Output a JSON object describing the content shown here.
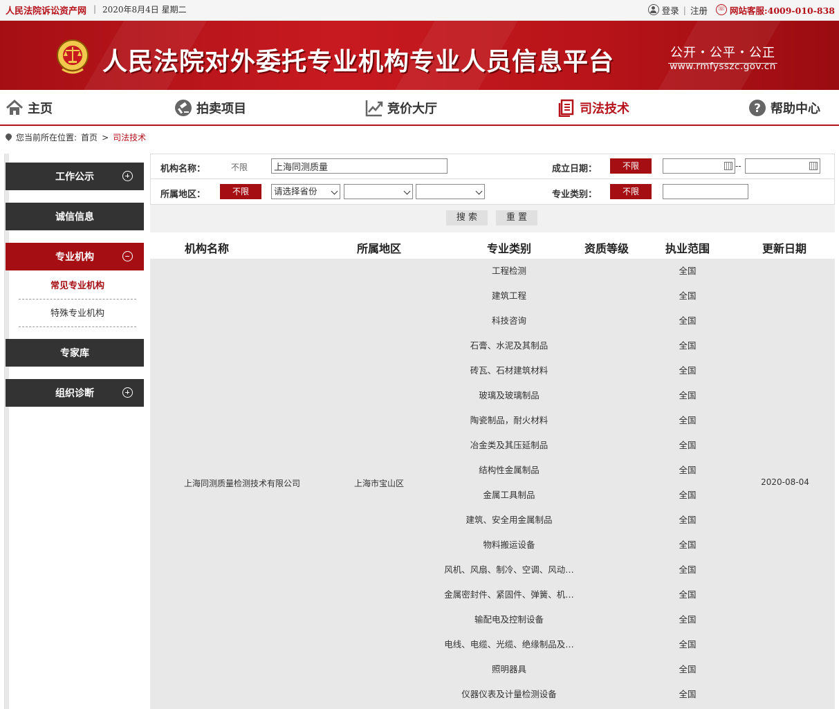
{
  "topbar": {
    "site_name": "人民法院诉讼资产网",
    "separator": "|",
    "date": "2020年8月4日  星期二",
    "login": "登录",
    "divider": "|",
    "register": "注册",
    "hotline": "网站客服:4009-010-838"
  },
  "banner": {
    "title": "人民法院对外委托专业机构专业人员信息平台",
    "slogan": "公开・公平・公正",
    "url": "www.rmfysszc.gov.cn"
  },
  "nav": {
    "items": [
      {
        "label": "主页",
        "icon": "home-icon"
      },
      {
        "label": "拍卖项目",
        "icon": "gavel-icon"
      },
      {
        "label": "竞价大厅",
        "icon": "chart-icon"
      },
      {
        "label": "司法技术",
        "icon": "document-icon"
      },
      {
        "label": "帮助中心",
        "icon": "help-icon"
      }
    ],
    "active": "司法技术"
  },
  "breadcrumb": {
    "prefix": "您当前所在位置:",
    "home": "首页",
    "arrow": ">",
    "current": "司法技术"
  },
  "sidebar": {
    "sections": [
      {
        "label": "工作公示",
        "toggle": "plus"
      },
      {
        "label": "诚信信息"
      },
      {
        "label": "专业机构",
        "toggle": "minus"
      },
      {
        "label": "专家库"
      },
      {
        "label": "组织诊断",
        "toggle": "plus"
      }
    ],
    "sub_items": [
      "常见专业机构",
      "特殊专业机构"
    ]
  },
  "filter": {
    "name_label": "机构名称：",
    "name_unlimited": "不限",
    "name_value": "上海同测质量",
    "date_label": "成立日期：",
    "date_unlimited": "不限",
    "date_separator": "--",
    "region_label": "所属地区：",
    "region_unlimited": "不限",
    "province_placeholder": "请选择省份",
    "category_label": "专业类别：",
    "category_unlimited": "不限"
  },
  "actions": {
    "search": "搜 索",
    "reset": "重 置"
  },
  "table": {
    "headers": [
      "机构名称",
      "所属地区",
      "专业类别",
      "资质等级",
      "执业范围",
      "更新日期"
    ],
    "row": {
      "name": "上海同测质量检测技术有限公司",
      "region": "上海市宝山区",
      "updated": "2020-08-04",
      "categories": [
        "工程检测",
        "建筑工程",
        "科技咨询",
        "石膏、水泥及其制品",
        "砖瓦、石材建筑材料",
        "玻璃及玻璃制品",
        "陶瓷制品，耐火材料",
        "冶金类及其压延制品",
        "结构性金属制品",
        "金属工具制品",
        "建筑、安全用金属制品",
        "物料搬运设备",
        "风机、风扇、制冷、空调、风动…",
        "金属密封件、紧固件、弹簧、机…",
        "输配电及控制设备",
        "电线、电缆、光缆、绝缘制品及…",
        "照明器具",
        "仪器仪表及计量检测设备"
      ],
      "scope": "全国"
    }
  }
}
